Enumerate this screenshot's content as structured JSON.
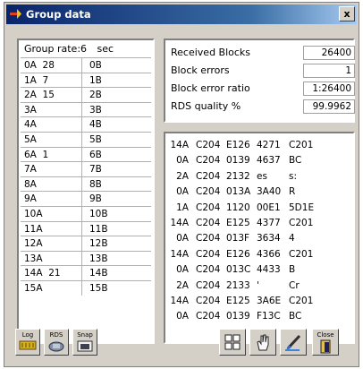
{
  "window": {
    "title": "Group data",
    "close_label": "x"
  },
  "group_rate": {
    "label": "Group rate:",
    "value": "6",
    "unit": "sec"
  },
  "groups": [
    {
      "a": "0A  28",
      "b": "0B"
    },
    {
      "a": "1A  7",
      "b": "1B"
    },
    {
      "a": "2A  15",
      "b": "2B"
    },
    {
      "a": "3A",
      "b": "3B"
    },
    {
      "a": "4A",
      "b": "4B"
    },
    {
      "a": "5A",
      "b": "5B"
    },
    {
      "a": "6A  1",
      "b": "6B"
    },
    {
      "a": "7A",
      "b": "7B"
    },
    {
      "a": "8A",
      "b": "8B"
    },
    {
      "a": "9A",
      "b": "9B"
    },
    {
      "a": "10A",
      "b": "10B"
    },
    {
      "a": "11A",
      "b": "11B"
    },
    {
      "a": "12A",
      "b": "12B"
    },
    {
      "a": "13A",
      "b": "13B"
    },
    {
      "a": "14A  21",
      "b": "14B"
    },
    {
      "a": "15A",
      "b": "15B"
    }
  ],
  "stats": [
    {
      "label": "Received Blocks",
      "value": "26400"
    },
    {
      "label": "Block errors",
      "value": "1"
    },
    {
      "label": "Block error ratio",
      "value": "1:26400"
    },
    {
      "label": "RDS quality %",
      "value": "99.9962"
    }
  ],
  "log": [
    {
      "g": "14A",
      "c1": "C204",
      "c2": "E126",
      "c3": "4271",
      "c4": "C201"
    },
    {
      "g": "0A",
      "c1": "C204",
      "c2": "0139",
      "c3": "4637",
      "c4": "BC"
    },
    {
      "g": "2A",
      "c1": "C204",
      "c2": "2132",
      "c3": "es",
      "c4": "s:"
    },
    {
      "g": "0A",
      "c1": "C204",
      "c2": "013A",
      "c3": "3A40",
      "c4": "R"
    },
    {
      "g": "1A",
      "c1": "C204",
      "c2": "1120",
      "c3": "00E1",
      "c4": "5D1E"
    },
    {
      "g": "14A",
      "c1": "C204",
      "c2": "E125",
      "c3": "4377",
      "c4": "C201"
    },
    {
      "g": "0A",
      "c1": "C204",
      "c2": "013F",
      "c3": "3634",
      "c4": "4"
    },
    {
      "g": "14A",
      "c1": "C204",
      "c2": "E126",
      "c3": "4366",
      "c4": "C201"
    },
    {
      "g": "0A",
      "c1": "C204",
      "c2": "013C",
      "c3": "4433",
      "c4": "B"
    },
    {
      "g": "2A",
      "c1": "C204",
      "c2": "2133",
      "c3": "'",
      "c4": "Cr"
    },
    {
      "g": "14A",
      "c1": "C204",
      "c2": "E125",
      "c3": "3A6E",
      "c4": "C201"
    },
    {
      "g": "0A",
      "c1": "C204",
      "c2": "0139",
      "c3": "F13C",
      "c4": "BC"
    }
  ],
  "toolbar": {
    "log_label": "Log",
    "rds_label": "RDS",
    "snap_label": "Snap",
    "close_label": "Close"
  }
}
